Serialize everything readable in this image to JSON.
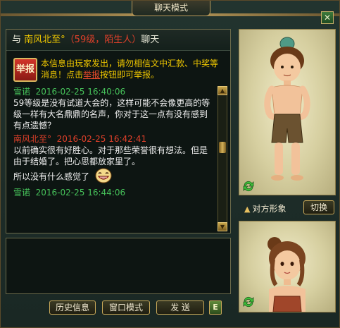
{
  "window": {
    "title": "聊天模式",
    "close_label": "✕"
  },
  "chat_header": {
    "prefix": "与",
    "target_name": "南风北至°",
    "target_info": "（59级，陌生人）",
    "suffix": "聊天"
  },
  "report": {
    "badge_label": "举报",
    "notice_part1": "本信息由玩家发出，请勿相信文中汇款、中奖等消息！点击",
    "notice_link": "举报",
    "notice_part2": "按钮即可举报。"
  },
  "messages": [
    {
      "sender": "雪诺",
      "time": "2016-02-25 16:40:06",
      "text": "59等级是没有试道大会的，这样可能不会像更高的等级一样有大名鼎鼎的名声，你对于这一点有没有感到有点遗憾？",
      "side": "a"
    },
    {
      "sender": "南风北至°",
      "time": "2016-02-25 16:42:41",
      "text": "以前确实很有好胜心。对于那些荣誉很有想法。但是由于结婚了。把心思都放家里了。",
      "side": "b"
    },
    {
      "sender": "",
      "time": "",
      "text": "所以没有什么感觉了",
      "side": "b",
      "emote": "grin-emote"
    },
    {
      "sender": "雪诺",
      "time": "2016-02-25 16:44:06",
      "text": "",
      "side": "a"
    }
  ],
  "scrollbar": {
    "up": "▲",
    "down": "▼"
  },
  "input": {
    "value": "",
    "placeholder": ""
  },
  "buttons": {
    "history": "历史信息",
    "window_mode": "窗口模式",
    "send": "发 送",
    "emoji": "E"
  },
  "portrait": {
    "target_label": "对方形象",
    "switch_label": "切换",
    "icons": [
      "refresh-icon",
      "chevron-up-icon"
    ]
  },
  "colors": {
    "name_yellow": "#f0c800",
    "level_red": "#e0402a",
    "sender_green": "#46c25a",
    "text_white": "#f0f0f0",
    "gold_border": "#c8a858"
  }
}
